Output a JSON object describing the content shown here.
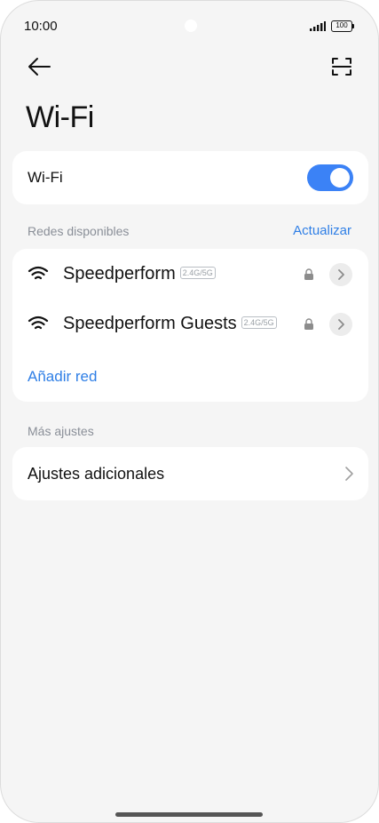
{
  "status_bar": {
    "time": "10:00",
    "battery": "100"
  },
  "header": {
    "title": "Wi-Fi"
  },
  "wifi_toggle": {
    "label": "Wi-Fi",
    "enabled": true
  },
  "available": {
    "section_label": "Redes disponibles",
    "refresh_label": "Actualizar",
    "networks": [
      {
        "name": "Speedperform",
        "band": "2.4G/5G",
        "secured": true
      },
      {
        "name": "Speedperform Guests",
        "band": "2.4G/5G",
        "secured": true
      }
    ],
    "add_label": "Añadir red"
  },
  "more": {
    "section_label": "Más ajustes",
    "items": [
      {
        "label": "Ajustes adicionales"
      }
    ]
  },
  "colors": {
    "accent": "#3b82f6",
    "link": "#2f7fe6",
    "background": "#f5f5f5"
  },
  "icons": [
    "back-arrow-icon",
    "scan-icon",
    "wifi-icon",
    "lock-icon",
    "chevron-right-icon",
    "signal-icon",
    "battery-icon"
  ]
}
